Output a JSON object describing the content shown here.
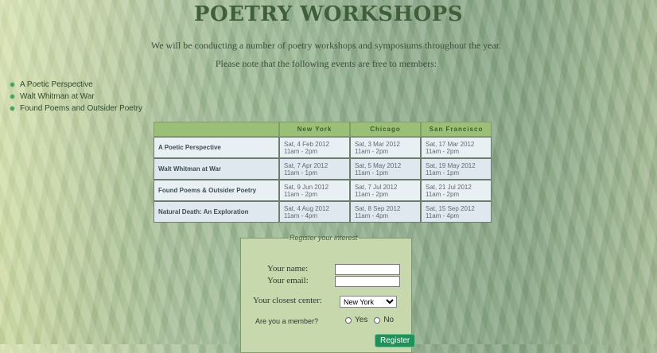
{
  "header": {
    "title": "POETRY WORKSHOPS",
    "intro_1": "We will be conducting a number of poetry workshops and symposiums throughout the year.",
    "intro_2": "Please note that the following events are free to members:"
  },
  "sidebar": {
    "items": [
      {
        "label": "A Poetic Perspective"
      },
      {
        "label": "Walt Whitman at War"
      },
      {
        "label": "Found Poems and Outsider Poetry"
      }
    ]
  },
  "events_table": {
    "columns": [
      "",
      "New York",
      "Chicago",
      "San Francisco"
    ],
    "rows": [
      {
        "name": "A Poetic Perspective",
        "cells": [
          {
            "date": "Sat, 4 Feb 2012",
            "time": "11am - 2pm"
          },
          {
            "date": "Sat, 3 Mar 2012",
            "time": "11am - 2pm"
          },
          {
            "date": "Sat, 17 Mar 2012",
            "time": "11am - 2pm"
          }
        ]
      },
      {
        "name": "Walt Whitman at War",
        "cells": [
          {
            "date": "Sat, 7 Apr 2012",
            "time": "11am - 1pm"
          },
          {
            "date": "Sat, 5 May 2012",
            "time": "11am - 1pm"
          },
          {
            "date": "Sat, 19 May 2012",
            "time": "11am - 1pm"
          }
        ]
      },
      {
        "name": "Found Poems & Outsider Poetry",
        "cells": [
          {
            "date": "Sat, 9 Jun 2012",
            "time": "11am - 2pm"
          },
          {
            "date": "Sat, 7 Jul 2012",
            "time": "11am - 2pm"
          },
          {
            "date": "Sat, 21 Jul 2012",
            "time": "11am - 2pm"
          }
        ]
      },
      {
        "name": "Natural Death: An Exploration",
        "cells": [
          {
            "date": "Sat, 4 Aug 2012",
            "time": "11am - 4pm"
          },
          {
            "date": "Sat, 8 Sep 2012",
            "time": "11am - 4pm"
          },
          {
            "date": "Sat, 15 Sep 2012",
            "time": "11am - 4pm"
          }
        ]
      }
    ]
  },
  "form": {
    "legend": "Register your interest",
    "name_label": "Your name:",
    "name_value": "",
    "email_label": "Your email:",
    "email_value": "",
    "center_label": "Your closest center:",
    "center_selected": "New York",
    "member_label": "Are you a member?",
    "yes_label": "Yes",
    "no_label": "No",
    "submit_label": "Register"
  },
  "colors": {
    "title": "#3f5f3a",
    "table_header": "#9cbf78",
    "submit": "#21915a"
  }
}
